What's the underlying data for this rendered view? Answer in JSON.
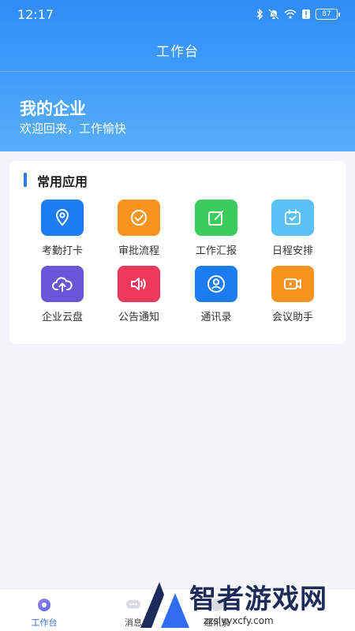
{
  "status_bar": {
    "time": "12:17",
    "battery": "87",
    "icons": [
      "bluetooth-icon",
      "mute-icon",
      "wifi-icon",
      "alert-icon",
      "battery-icon"
    ]
  },
  "header": {
    "title": "工作台"
  },
  "company": {
    "name": "我的企业",
    "welcome": "欢迎回来，工作愉快"
  },
  "section": {
    "title": "常用应用",
    "apps": [
      {
        "label": "考勤打卡",
        "icon": "location-pin-icon",
        "color": "#1d7cf2"
      },
      {
        "label": "审批流程",
        "icon": "check-circle-icon",
        "color": "#f7931e"
      },
      {
        "label": "工作汇报",
        "icon": "edit-note-icon",
        "color": "#3ccc5c"
      },
      {
        "label": "日程安排",
        "icon": "calendar-check-icon",
        "color": "#5bc2f5"
      },
      {
        "label": "企业云盘",
        "icon": "cloud-upload-icon",
        "color": "#6a55d6"
      },
      {
        "label": "公告通知",
        "icon": "speaker-icon",
        "color": "#ef3a5d"
      },
      {
        "label": "通讯录",
        "icon": "contact-icon",
        "color": "#1d7cf2"
      },
      {
        "label": "会议助手",
        "icon": "video-icon",
        "color": "#f7931e"
      }
    ]
  },
  "tabbar": {
    "tabs": [
      {
        "label": "工作台",
        "icon": "workbench-icon",
        "active": true
      },
      {
        "label": "消息",
        "icon": "message-icon",
        "active": false
      },
      {
        "label": "通讯录",
        "icon": "contacts-tab-icon",
        "active": false
      }
    ]
  },
  "watermark": {
    "text": "智者游戏网",
    "url": "zzslyyxcfy.com"
  }
}
